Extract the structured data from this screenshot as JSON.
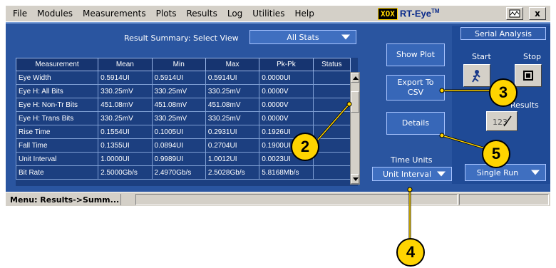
{
  "menu": [
    "File",
    "Modules",
    "Measurements",
    "Plots",
    "Results",
    "Log",
    "Utilities",
    "Help"
  ],
  "brand": {
    "logo": "XOX",
    "name": "RT-Eye",
    "tm": "TM"
  },
  "window_buttons": {
    "minimize_icon": "scope-icon",
    "close": "x"
  },
  "summary": {
    "label": "Result Summary: Select View",
    "view": "All Stats"
  },
  "table": {
    "headers": [
      "Measurement",
      "Mean",
      "Min",
      "Max",
      "Pk-Pk",
      "Status"
    ],
    "rows": [
      [
        "Eye Width",
        "0.5914UI",
        "0.5914UI",
        "0.5914UI",
        "0.0000UI",
        ""
      ],
      [
        "Eye H: All Bits",
        "330.25mV",
        "330.25mV",
        "330.25mV",
        "0.0000V",
        ""
      ],
      [
        "Eye H: Non-Tr Bits",
        "451.08mV",
        "451.08mV",
        "451.08mV",
        "0.0000V",
        ""
      ],
      [
        "Eye H: Trans Bits",
        "330.25mV",
        "330.25mV",
        "330.25mV",
        "0.0000V",
        ""
      ],
      [
        "Rise Time",
        "0.1554UI",
        "0.1005UI",
        "0.2931UI",
        "0.1926UI",
        ""
      ],
      [
        "Fall Time",
        "0.1355UI",
        "0.0894UI",
        "0.2704UI",
        "0.1900UI",
        ""
      ],
      [
        "Unit Interval",
        "1.0000UI",
        "0.9989UI",
        "1.0012UI",
        "0.0023UI",
        ""
      ],
      [
        "Bit Rate",
        "2.5000Gb/s",
        "2.4970Gb/s",
        "2.5028Gb/s",
        "5.8168Mb/s",
        ""
      ]
    ]
  },
  "buttons": {
    "show_plot": "Show Plot",
    "export": "Export To CSV",
    "details": "Details"
  },
  "time_units": {
    "label": "Time Units",
    "value": "Unit Interval"
  },
  "serial": {
    "title": "Serial Analysis",
    "start": "Start",
    "stop": "Stop",
    "results_label": "Results",
    "run_mode": "Single Run"
  },
  "status": {
    "menu_path": "Menu: Results->Summ..."
  },
  "callouts": [
    "2",
    "3",
    "4",
    "5"
  ],
  "colors": {
    "panel": "#2a55a0",
    "callout": "#ffd400",
    "menubar": "#d4d0c8"
  }
}
